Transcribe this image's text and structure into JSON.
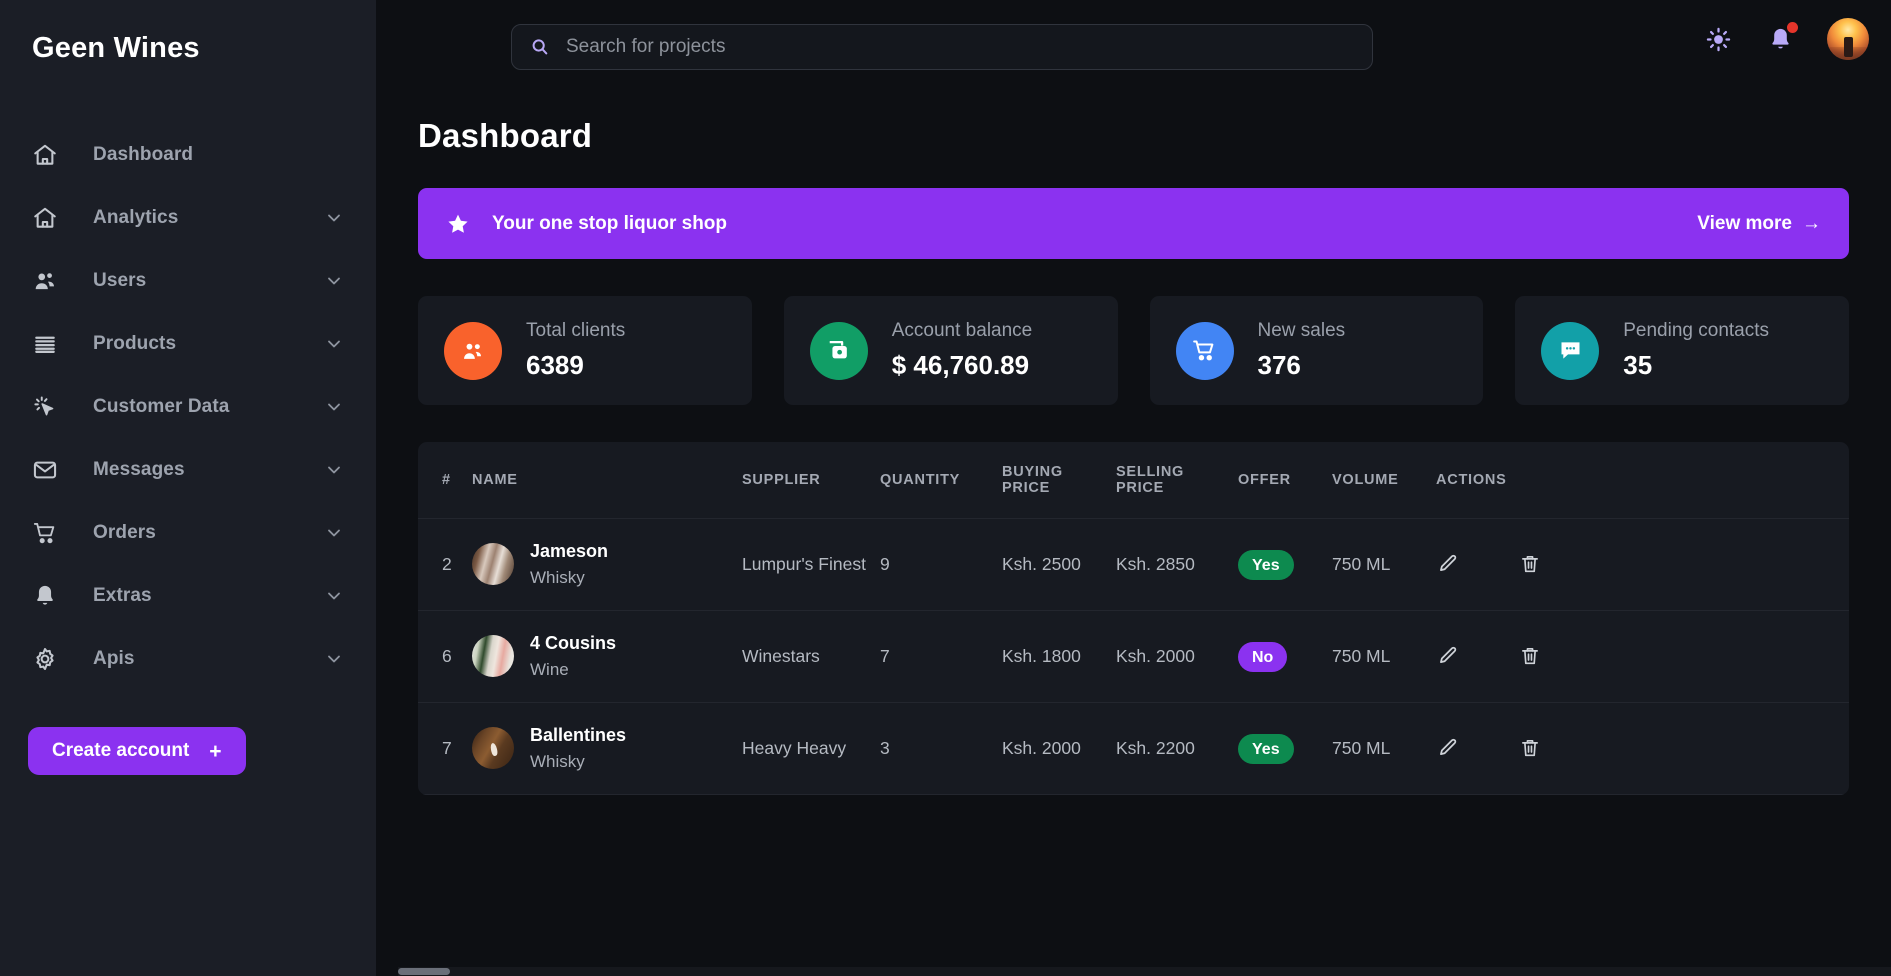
{
  "brand": {
    "name": "Geen Wines"
  },
  "search": {
    "placeholder": "Search for projects",
    "value": "",
    "icon": "search-icon"
  },
  "topbar": {
    "theme_toggle_icon": "sun-icon",
    "notifications_icon": "bell-icon",
    "has_notification": true,
    "avatar_icon": "user-avatar"
  },
  "sidebar": {
    "items": [
      {
        "label": "Dashboard",
        "icon": "home-icon",
        "expandable": false
      },
      {
        "label": "Analytics",
        "icon": "home-icon",
        "expandable": true
      },
      {
        "label": "Users",
        "icon": "users-icon",
        "expandable": true
      },
      {
        "label": "Products",
        "icon": "list-lines-icon",
        "expandable": true
      },
      {
        "label": "Customer Data",
        "icon": "cursor-click-icon",
        "expandable": true
      },
      {
        "label": "Messages",
        "icon": "envelope-icon",
        "expandable": true
      },
      {
        "label": "Orders",
        "icon": "shopping-cart-icon",
        "expandable": true
      },
      {
        "label": "Extras",
        "icon": "bell-icon",
        "expandable": true
      },
      {
        "label": "Apis",
        "icon": "gear-icon",
        "expandable": true
      }
    ],
    "create_account_label": "Create account",
    "create_account_plus": "+"
  },
  "main": {
    "page_title": "Dashboard",
    "banner": {
      "icon": "star-icon",
      "text": "Your one stop liquor shop",
      "link_label": "View more",
      "link_arrow": "→",
      "color": "#8b32f0"
    },
    "cards": [
      {
        "label": "Total clients",
        "value": "6389",
        "icon": "users-group-icon",
        "color": "#f9622c"
      },
      {
        "label": "Account balance",
        "value": "$ 46,760.89",
        "icon": "wallet-icon",
        "color": "#119e66"
      },
      {
        "label": "New sales",
        "value": "376",
        "icon": "shopping-cart-icon",
        "color": "#4285f4"
      },
      {
        "label": "Pending contacts",
        "value": "35",
        "icon": "chat-bubble-icon",
        "color": "#12a0a8"
      }
    ],
    "table": {
      "columns": [
        "#",
        "NAME",
        "SUPPLIER",
        "QUANTITY",
        "BUYING PRICE",
        "SELLING PRICE",
        "OFFER",
        "VOLUME",
        "ACTIONS"
      ],
      "rows": [
        {
          "num": "2",
          "name": "Jameson",
          "category": "Whisky",
          "image": "jameson",
          "supplier": "Lumpur's Finest",
          "quantity": "9",
          "buying_price": "Ksh. 2500",
          "selling_price": "Ksh. 2850",
          "offer": "Yes",
          "offer_state": "yes",
          "volume": "750 ML",
          "edit_icon": "pencil-icon",
          "delete_icon": "trash-icon"
        },
        {
          "num": "6",
          "name": "4 Cousins",
          "category": "Wine",
          "image": "cousins",
          "supplier": "Winestars",
          "quantity": "7",
          "buying_price": "Ksh. 1800",
          "selling_price": "Ksh. 2000",
          "offer": "No",
          "offer_state": "no",
          "volume": "750 ML",
          "edit_icon": "pencil-icon",
          "delete_icon": "trash-icon"
        },
        {
          "num": "7",
          "name": "Ballentines",
          "category": "Whisky",
          "image": "ballentines",
          "supplier": "Heavy Heavy",
          "quantity": "3",
          "buying_price": "Ksh. 2000",
          "selling_price": "Ksh. 2200",
          "offer": "Yes",
          "offer_state": "yes",
          "volume": "750 ML",
          "edit_icon": "pencil-icon",
          "delete_icon": "trash-icon"
        }
      ]
    }
  }
}
